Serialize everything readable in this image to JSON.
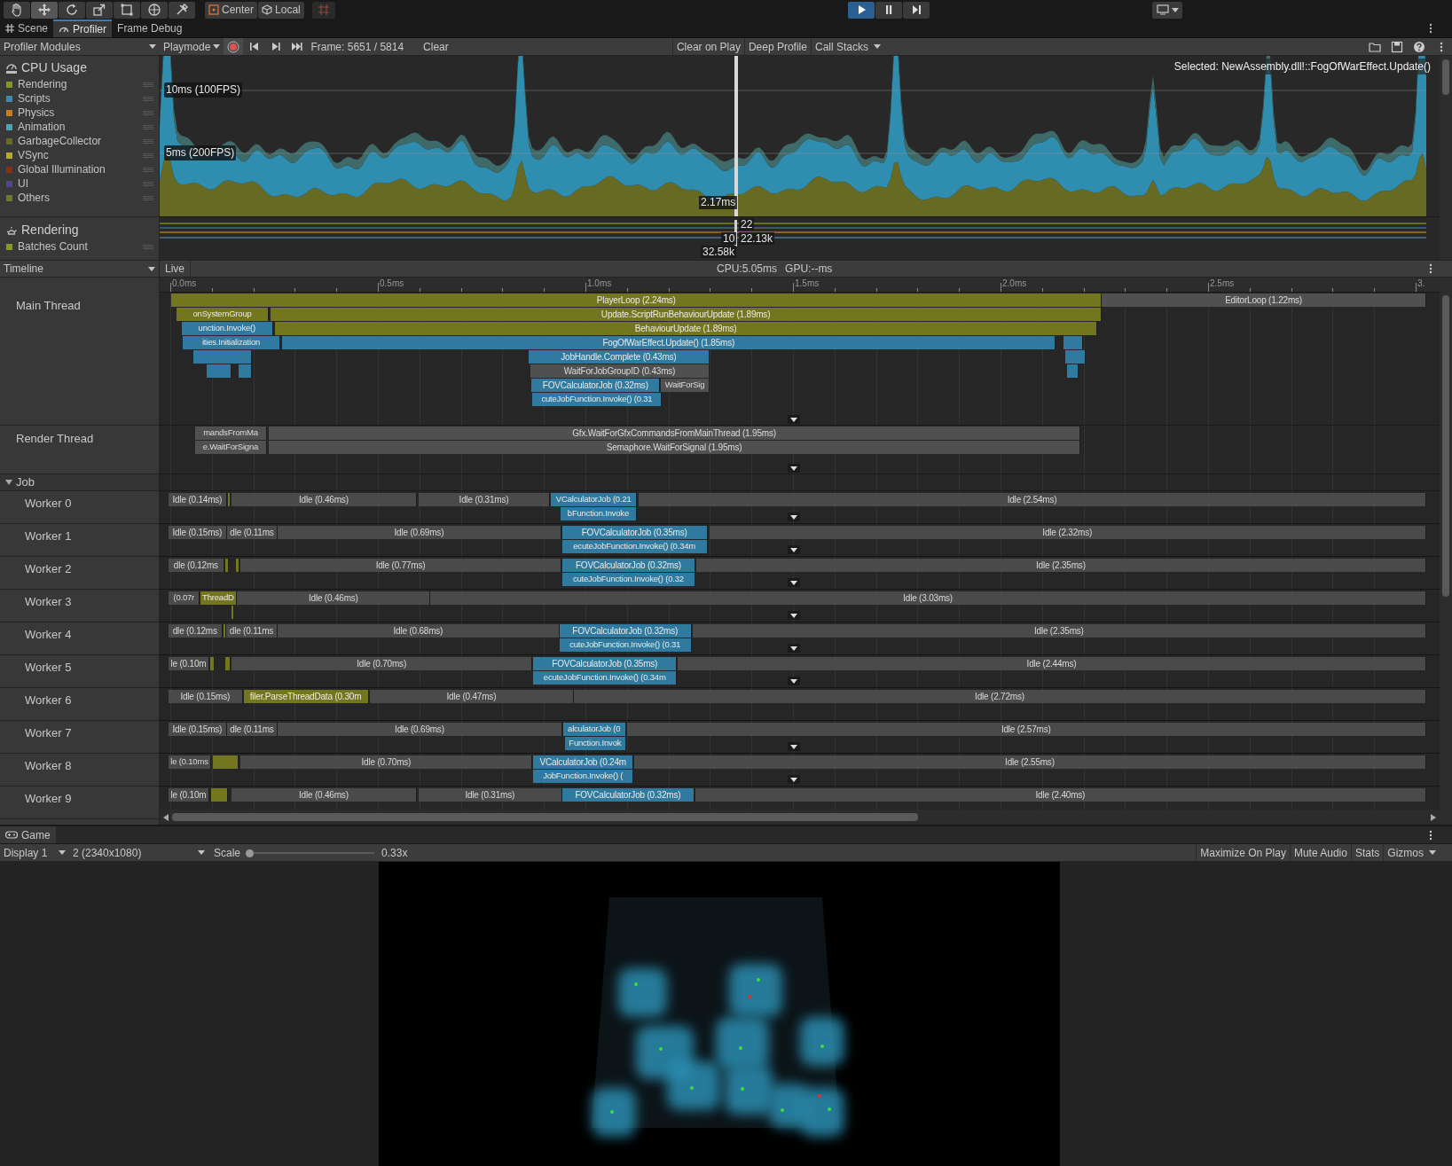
{
  "toolbar": {
    "tools": [
      {
        "kind": "hand",
        "selected": false
      },
      {
        "kind": "move",
        "selected": true
      },
      {
        "kind": "rotate",
        "selected": false
      },
      {
        "kind": "scale",
        "selected": false
      },
      {
        "kind": "rect",
        "selected": false
      },
      {
        "kind": "transform",
        "selected": false
      },
      {
        "kind": "custom",
        "selected": false
      }
    ],
    "pivot": [
      {
        "label": "Center",
        "kind": "center"
      },
      {
        "label": "Local",
        "kind": "local"
      }
    ],
    "play_controls": [
      {
        "kind": "play",
        "on": true
      },
      {
        "kind": "pause",
        "on": false
      },
      {
        "kind": "step",
        "on": false
      }
    ]
  },
  "tabs": [
    {
      "label": "Scene",
      "kind": "scene",
      "selected": false
    },
    {
      "label": "Profiler",
      "kind": "profiler",
      "selected": true
    },
    {
      "label": "Frame Debug",
      "kind": "plain",
      "selected": false
    }
  ],
  "profiler_toolbar": {
    "modules": "Profiler Modules",
    "target": "Playmode",
    "recording": true,
    "frame": "Frame: 5651 / 5814",
    "clear": "Clear",
    "toggles": [
      "Clear on Play",
      "Deep Profile"
    ],
    "call_stacks": "Call Stacks"
  },
  "cpu_module": {
    "title": "CPU Usage",
    "legend": [
      {
        "label": "Rendering",
        "color": "#7d9a1c"
      },
      {
        "label": "Scripts",
        "color": "#3a8db0"
      },
      {
        "label": "Physics",
        "color": "#d07a16"
      },
      {
        "label": "Animation",
        "color": "#46a6b8"
      },
      {
        "label": "GarbageCollector",
        "color": "#6b6b20"
      },
      {
        "label": "VSync",
        "color": "#b8ac1e"
      },
      {
        "label": "Global Illumination",
        "color": "#8b2e14"
      },
      {
        "label": "UI",
        "color": "#4a4a8a"
      },
      {
        "label": "Others",
        "color": "#6e7a2a"
      }
    ],
    "selected": "Selected: NewAssembly.dll!::FogOfWarEffect.Update()",
    "guides": [
      "10ms (100FPS)",
      "5ms (200FPS)"
    ],
    "frame_value": "2.17ms"
  },
  "rendering_module": {
    "title": "Rendering",
    "legend": [
      {
        "label": "Batches Count",
        "color": "#8a9a1a"
      }
    ],
    "values": [
      "22",
      "10",
      "22.13k",
      "32.58k"
    ]
  },
  "timeline": {
    "view": "Timeline",
    "mode": "Live",
    "cpu": "CPU:5.05ms",
    "gpu": "GPU:--ms",
    "ticks": [
      "0.0ms",
      "0.5ms",
      "1.0ms",
      "1.5ms",
      "2.0ms",
      "2.5ms",
      "3."
    ],
    "threads": [
      {
        "name": "Main Thread",
        "rows": [
          [
            {
              "label": "PlayerLoop (2.24ms)",
              "kind": "other"
            },
            {
              "label": "EditorLoop (1.22ms)",
              "kind": "wait"
            }
          ],
          [
            {
              "label": "onSystemGroup",
              "kind": "other"
            },
            {
              "label": "Update.ScriptRunBehaviourUpdate (1.89ms)",
              "kind": "other"
            }
          ],
          [
            {
              "label": "unction.Invoke()",
              "kind": "script"
            },
            {
              "label": "BehaviourUpdate (1.89ms)",
              "kind": "other"
            }
          ],
          [
            {
              "label": "ities.Initialization",
              "kind": "script"
            },
            {
              "label": "FogOfWarEffect.Update() (1.85ms)",
              "kind": "script"
            },
            {
              "kind": "script"
            }
          ],
          [
            {
              "kind": "script"
            },
            {
              "label": "JobHandle.Complete (0.43ms)",
              "kind": "script"
            },
            {
              "kind": "script"
            }
          ],
          [
            {
              "kind": "script"
            },
            {
              "kind": "script"
            },
            {
              "label": "WaitForJobGroupID (0.43ms)",
              "kind": "wait"
            },
            {
              "kind": "script"
            }
          ],
          [
            {
              "label": "FOVCalculatorJob (0.32ms)",
              "kind": "script"
            },
            {
              "label": "WaitForSig",
              "kind": "wait"
            }
          ],
          [
            {
              "label": "cuteJobFunction.Invoke() (0.31",
              "kind": "script"
            }
          ]
        ]
      },
      {
        "name": "Render Thread",
        "rows": [
          [
            {
              "label": "mandsFromMa",
              "kind": "wait"
            },
            {
              "label": "Gfx.WaitForGfxCommandsFromMainThread (1.95ms)",
              "kind": "wait"
            }
          ],
          [
            {
              "label": "e.WaitForSigna",
              "kind": "wait"
            },
            {
              "label": "Semaphore.WaitForSignal (1.95ms)",
              "kind": "wait"
            }
          ]
        ]
      }
    ],
    "job_group": {
      "label": "Job",
      "expanded": true,
      "workers": [
        {
          "name": "Worker 0",
          "samples": [
            {
              "label": "Idle (0.14ms)",
              "kind": "idle"
            },
            {
              "kind": "other"
            },
            {
              "label": "Idle (0.46ms)",
              "kind": "idle"
            },
            {
              "label": "Idle (0.31ms)",
              "kind": "idle"
            },
            {
              "label": "VCalculatorJob (0.21",
              "kind": "script",
              "children": [
                {
                  "label": "bFunction.Invoke",
                  "kind": "script"
                }
              ]
            },
            {
              "label": "Idle (2.54ms)",
              "kind": "idle"
            }
          ]
        },
        {
          "name": "Worker 1",
          "samples": [
            {
              "label": "Idle (0.15ms)",
              "kind": "idle"
            },
            {
              "label": "dle (0.11ms",
              "kind": "idle"
            },
            {
              "label": "Idle (0.69ms)",
              "kind": "idle"
            },
            {
              "label": "FOVCalculatorJob (0.35ms)",
              "kind": "script",
              "children": [
                {
                  "label": "ecuteJobFunction.Invoke() (0.34m",
                  "kind": "script"
                }
              ]
            },
            {
              "label": "Idle (2.32ms)",
              "kind": "idle"
            }
          ]
        },
        {
          "name": "Worker 2",
          "samples": [
            {
              "label": "dle (0.12ms",
              "kind": "idle"
            },
            {
              "kind": "other"
            },
            {
              "kind": "other"
            },
            {
              "label": "Idle (0.77ms)",
              "kind": "idle"
            },
            {
              "label": "FOVCalculatorJob (0.32ms)",
              "kind": "script",
              "children": [
                {
                  "label": "cuteJobFunction.Invoke() (0.32",
                  "kind": "script"
                }
              ]
            },
            {
              "label": "Idle (2.35ms)",
              "kind": "idle"
            }
          ]
        },
        {
          "name": "Worker 3",
          "samples": [
            {
              "label": "(0.07r",
              "kind": "idle"
            },
            {
              "label": "ThreadD",
              "kind": "other",
              "children": [
                {
                  "kind": "other"
                }
              ]
            },
            {
              "label": "Idle (0.46ms)",
              "kind": "idle"
            },
            {
              "label": "Idle (3.03ms)",
              "kind": "idle"
            }
          ]
        },
        {
          "name": "Worker 4",
          "samples": [
            {
              "label": "dle (0.12ms",
              "kind": "idle"
            },
            {
              "kind": "other"
            },
            {
              "label": "dle (0.11ms",
              "kind": "idle"
            },
            {
              "label": "Idle (0.68ms)",
              "kind": "idle"
            },
            {
              "label": "FOVCalculatorJob (0.32ms)",
              "kind": "script",
              "children": [
                {
                  "label": "cuteJobFunction.Invoke() (0.31",
                  "kind": "script"
                }
              ]
            },
            {
              "label": "Idle (2.35ms)",
              "kind": "idle"
            }
          ]
        },
        {
          "name": "Worker 5",
          "samples": [
            {
              "label": "le (0.10m",
              "kind": "idle"
            },
            {
              "kind": "other"
            },
            {
              "kind": "other"
            },
            {
              "label": "Idle (0.70ms)",
              "kind": "idle"
            },
            {
              "label": "FOVCalculatorJob (0.35ms)",
              "kind": "script",
              "children": [
                {
                  "label": "ecuteJobFunction.Invoke() (0.34m",
                  "kind": "script"
                }
              ]
            },
            {
              "label": "Idle (2.44ms)",
              "kind": "idle"
            }
          ]
        },
        {
          "name": "Worker 6",
          "samples": [
            {
              "label": "Idle (0.15ms)",
              "kind": "idle"
            },
            {
              "label": "filer.ParseThreadData (0.30m",
              "kind": "other"
            },
            {
              "label": "Idle (0.47ms)",
              "kind": "idle"
            },
            {
              "label": "Idle (2.72ms)",
              "kind": "idle"
            }
          ]
        },
        {
          "name": "Worker 7",
          "samples": [
            {
              "label": "Idle (0.15ms)",
              "kind": "idle"
            },
            {
              "label": "dle (0.11ms",
              "kind": "idle"
            },
            {
              "label": "Idle (0.69ms)",
              "kind": "idle"
            },
            {
              "label": "alculatorJob (0",
              "kind": "script",
              "children": [
                {
                  "label": "Function.Invok",
                  "kind": "script"
                }
              ]
            },
            {
              "label": "Idle (2.57ms)",
              "kind": "idle"
            }
          ]
        },
        {
          "name": "Worker 8",
          "samples": [
            {
              "label": "le (0.10ms",
              "kind": "idle"
            },
            {
              "kind": "other"
            },
            {
              "label": "Idle (0.70ms)",
              "kind": "idle"
            },
            {
              "label": "VCalculatorJob (0.24m",
              "kind": "script",
              "children": [
                {
                  "label": "JobFunction.Invoke() (",
                  "kind": "script"
                }
              ]
            },
            {
              "label": "Idle (2.55ms)",
              "kind": "idle"
            }
          ]
        },
        {
          "name": "Worker 9",
          "samples": [
            {
              "label": "le (0.10m",
              "kind": "idle"
            },
            {
              "kind": "other"
            },
            {
              "label": "Idle (0.46ms)",
              "kind": "idle"
            },
            {
              "label": "Idle (0.31ms)",
              "kind": "idle"
            },
            {
              "label": "FOVCalculatorJob (0.32ms)",
              "kind": "script"
            },
            {
              "label": "Idle (2.40ms)",
              "kind": "idle"
            }
          ]
        }
      ]
    }
  },
  "game": {
    "tab": "Game",
    "display": "Display 1",
    "resolution": "2 (2340x1080)",
    "scale_label": "Scale",
    "scale": {
      "level": 0
    },
    "scale_value": "0.33x",
    "buttons": [
      "Maximize On Play",
      "Mute Audio",
      "Stats"
    ],
    "gizmos": "Gizmos"
  }
}
